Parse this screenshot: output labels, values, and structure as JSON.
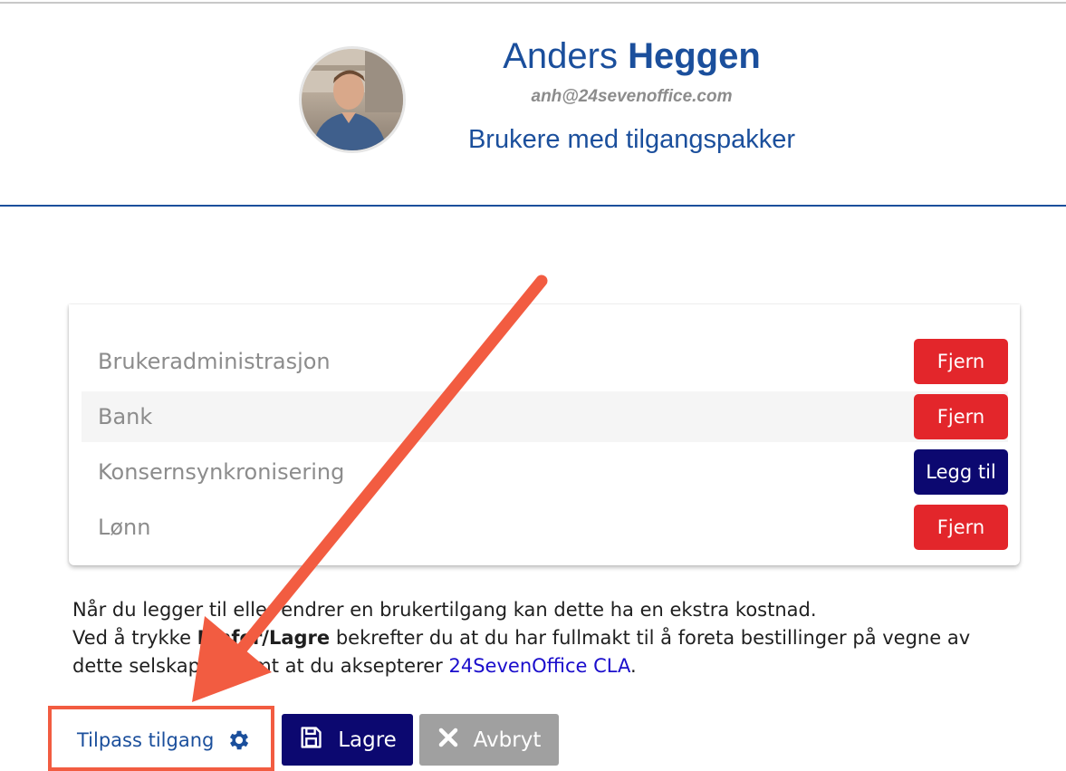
{
  "profile": {
    "first_name": "Anders",
    "last_name": "Heggen",
    "email": "anh@24sevenoffice.com",
    "subtitle": "Brukere med tilgangspakker"
  },
  "packages": [
    {
      "label": "Brukeradministrasjon",
      "action": "Fjern",
      "action_type": "remove"
    },
    {
      "label": "Bank",
      "action": "Fjern",
      "action_type": "remove"
    },
    {
      "label": "Konsernsynkronisering",
      "action": "Legg til",
      "action_type": "add"
    },
    {
      "label": "Lønn",
      "action": "Fjern",
      "action_type": "remove"
    }
  ],
  "notice": {
    "line1": "Når du legger til eller endrer en brukertilgang kan dette ha en ekstra kostnad.",
    "line2_pre": "Ved å trykke ",
    "line2_bold": "Innfør/Lagre",
    "line2_post": " bekrefter du at du har fullmakt til å foreta bestillinger på vegne av",
    "line3_pre": "dette selskapet, samt at du aksepterer ",
    "line3_link": "24SevenOffice CLA",
    "line3_post": "."
  },
  "actions": {
    "customize_label": "Tilpass tilgang",
    "save_label": "Lagre",
    "cancel_label": "Avbryt"
  },
  "colors": {
    "brand_blue": "#1b4f9c",
    "navy": "#0c0870",
    "remove_red": "#e3262b",
    "annotation_orange": "#f25c41",
    "cancel_gray": "#a0a0a0"
  },
  "icons": {
    "customize": "gear-icon",
    "save": "floppy-disk-icon",
    "cancel": "x-icon",
    "annotation": "arrow-annotation"
  }
}
